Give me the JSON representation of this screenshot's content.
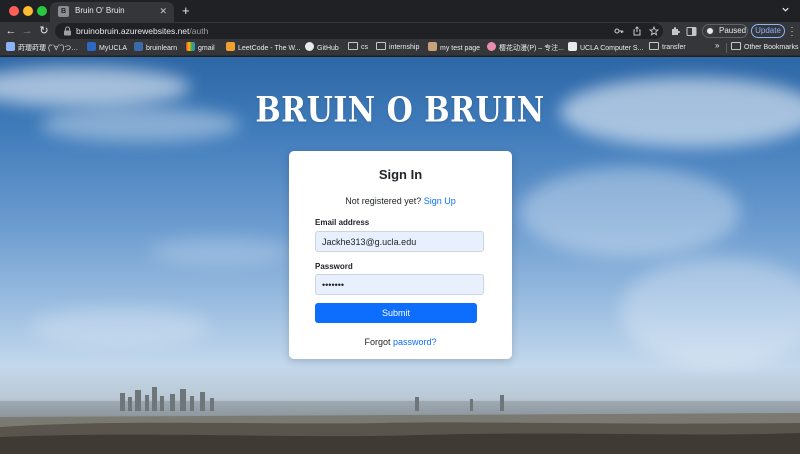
{
  "tab": {
    "title": "Bruin O' Bruin",
    "favicon_text": "B"
  },
  "toolbar": {
    "url_host": "bruinobruin.azurewebsites.net",
    "url_path": "/auth",
    "profile_status": "Paused",
    "update_label": "Update"
  },
  "bookmarks": {
    "items": [
      {
        "label": "莳璎莳璎 (˘∀˘)つ…"
      },
      {
        "label": "MyUCLA"
      },
      {
        "label": "bruinlearn"
      },
      {
        "label": "gmail"
      },
      {
        "label": "LeetCode - The W..."
      },
      {
        "label": "GitHub"
      },
      {
        "label": "cs"
      },
      {
        "label": "internship"
      },
      {
        "label": "my test page"
      },
      {
        "label": "樱花动漫(P) – 专注..."
      },
      {
        "label": "UCLA Computer S..."
      },
      {
        "label": "transfer"
      }
    ],
    "more": "»",
    "other": "Other Bookmarks"
  },
  "colors": {
    "accent": "#0d6efd",
    "autofill": "#e8f0fe",
    "chrome_dark": "#202124",
    "chrome_toolbar": "#35363a"
  },
  "page": {
    "brand": "BRUIN O BRUIN",
    "signin": {
      "title": "Sign In",
      "not_registered": "Not registered yet?",
      "signup_link": "Sign Up",
      "email_label": "Email address",
      "email_value": "Jackhe313@g.ucla.edu",
      "password_label": "Password",
      "password_value": "•••••••",
      "submit_label": "Submit",
      "forgot_prefix": "Forgot",
      "forgot_link": "password?"
    }
  }
}
